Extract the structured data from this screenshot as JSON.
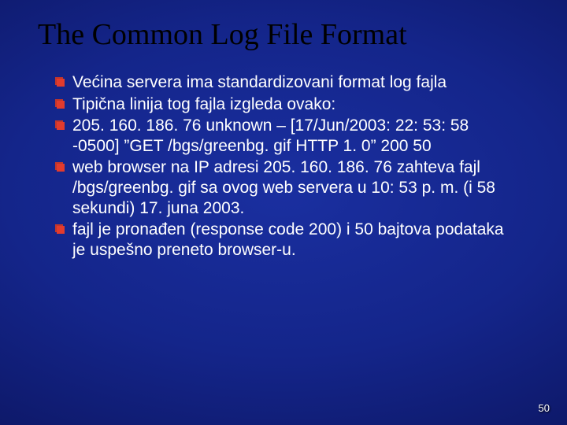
{
  "title": "The Common Log File Format",
  "bullets": [
    "Većina servera ima standardizovani format log fajla",
    "Tipična linija tog fajla izgleda ovako:",
    "205. 160. 186. 76 unknown – [17/Jun/2003: 22: 53: 58 -0500]  ”GET /bgs/greenbg. gif HTTP 1. 0” 200 50",
    "web browser na IP adresi 205. 160. 186. 76 zahteva fajl /bgs/greenbg. gif sa ovog web servera u 10: 53 p. m. (i 58 sekundi) 17. juna 2003.",
    "fajl je pronađen (response code 200) i 50 bajtova podataka je uspešno preneto browser-u."
  ],
  "page_number": "50"
}
